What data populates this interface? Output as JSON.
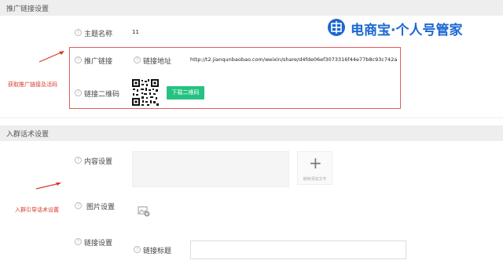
{
  "promo_section": {
    "title": "推广链接设置",
    "topic_label": "主题名称",
    "topic_value": "11",
    "promo_link_label": "推广链接",
    "link_address_label": "链接地址",
    "link_url": "http://t2.jianqunbaobao.com/weixin/share/d4fde06ef3073316f44e77b8c93c742a",
    "qr_label": "链接二维码",
    "download_button": "下载二维码"
  },
  "group_section": {
    "title": "入群话术设置",
    "content_label": "内容设置",
    "add_text_label": "继续添加文字",
    "image_label": "图片设置",
    "link_label": "链接设置",
    "link_title_label": "链接标题"
  },
  "annotations": {
    "get_link": "获取推广链接及活码",
    "group_script": "入群引导话术设置"
  },
  "brand": {
    "logo_text": "电商宝·个人号管家",
    "color": "#1b67d2"
  },
  "colors": {
    "accent_green": "#26c281",
    "annotation_red": "#d73b2b"
  },
  "icons": {
    "help": "question-circle-icon",
    "add": "plus-icon",
    "image": "add-image-icon",
    "arrow": "red-arrow-icon"
  }
}
